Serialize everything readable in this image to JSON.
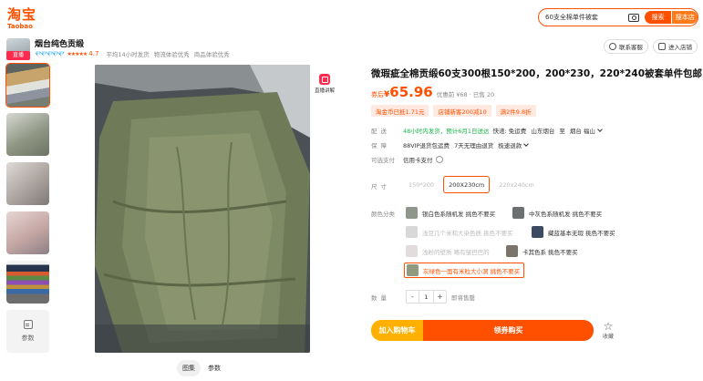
{
  "header": {
    "logo_cn": "淘宝",
    "logo_en": "Taobao",
    "search_value": "60支全棉单件被套",
    "search_btn": "搜索",
    "store_btn": "搜本店",
    "accent": "#ff5000"
  },
  "shop": {
    "name": "烟台纯色贡缎",
    "live_badge": "直播",
    "diamonds": "💎💎💎💎💎",
    "stars": "★★★★★",
    "score": "4.7",
    "meta1": "平均14小时发货",
    "meta2": "物流体验优秀",
    "meta3": "商品体验优秀",
    "contact": "联系客服",
    "enter_store": "进入店铺"
  },
  "gallery": {
    "params_label": "参数",
    "side_live_label": "直播讲解",
    "tab_image": "图集",
    "tab_params": "参数"
  },
  "product": {
    "title": "微瑕疵全棉贡缎60支300根150*200，200*230，220*240被套单件包邮",
    "price_label": "券后",
    "price_currency": "¥",
    "price": "65.96",
    "price_sub": "优惠前 ¥68 · 已售 20",
    "coupons": [
      "淘金币已抵1.71元",
      "店铺新客200减10",
      "满2件9.8折"
    ],
    "shipping_label": "配送",
    "shipping_green": "48小时内发货，预计6月1日送达",
    "shipping_rest": [
      "快递: 免运费",
      "山东烟台",
      "至",
      "烟台 福山"
    ],
    "guarantee_label": "保障",
    "guarantee_items": [
      "88VIP退货包运费",
      "7天无理由退货",
      "极速退款"
    ],
    "pay_label": "可选支付",
    "pay_value": "信用卡支付",
    "size_label": "尺寸",
    "sizes": [
      "150*200",
      "200X230cm",
      "220x240cm"
    ],
    "color_label": "颜色分类",
    "colors": [
      {
        "label": "银白色系随机发 挑色不要买",
        "state": "normal",
        "swatch": "#8f978c"
      },
      {
        "label": "中灰色系随机发 挑色不要买",
        "state": "normal",
        "swatch": "#6d7070"
      },
      {
        "label": "浅豆几个米和大染色质 挑色不要买",
        "state": "disabled",
        "swatch": "#d8d8d8"
      },
      {
        "label": "藏蓝基本无瑕 挑色不要买",
        "state": "normal",
        "swatch": "#3c4a62"
      },
      {
        "label": "浅粉的壁质 略有皱巴巴的",
        "state": "disabled",
        "swatch": "#e3dcdc"
      },
      {
        "label": "卡其色系 挑色不要买",
        "state": "normal",
        "swatch": "#7a746a"
      },
      {
        "label": "灰绿色一面有米粒大小洞 挑色不要买",
        "state": "selected",
        "swatch": "#8f9a7e"
      }
    ],
    "qty_label": "数量",
    "qty_minus": "-",
    "qty_value": "1",
    "qty_plus": "+",
    "qty_tip": "即将售罄",
    "add_cart": "加入购物车",
    "buy": "领券购买",
    "favorite": "收藏"
  }
}
